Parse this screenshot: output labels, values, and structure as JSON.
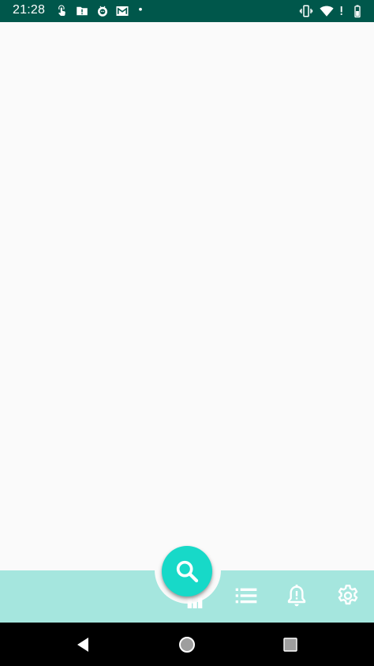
{
  "status_bar": {
    "time": "21:28",
    "notification_icons": [
      "touch-gesture-icon",
      "alert-folder-icon",
      "bug-icon",
      "mail-icon",
      "dot-icon"
    ],
    "system_icons": [
      "vibrate-icon",
      "wifi-icon",
      "battery-icon"
    ]
  },
  "colors": {
    "status_bar": "#00574b",
    "bottom_bar": "#a5e6de",
    "fab": "#17d9c8",
    "background": "#fafafa"
  },
  "bottom_bar": {
    "fab_icon": "search-icon",
    "items": [
      {
        "icon": "chart-icon"
      },
      {
        "icon": "list-icon"
      },
      {
        "icon": "bell-alert-icon"
      },
      {
        "icon": "gear-icon"
      }
    ]
  },
  "system_nav": {
    "buttons": [
      "back-icon",
      "home-icon",
      "recents-icon"
    ]
  }
}
